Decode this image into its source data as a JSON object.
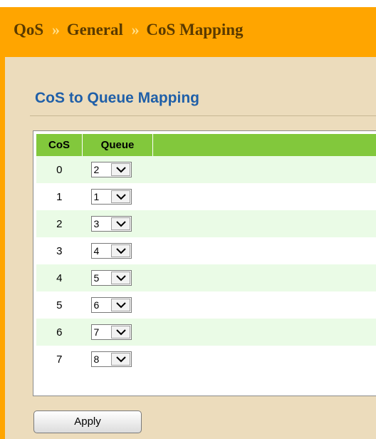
{
  "breadcrumb": {
    "items": [
      "QoS",
      "General",
      "CoS Mapping"
    ],
    "separator": "»"
  },
  "section": {
    "title": "CoS to Queue Mapping"
  },
  "table": {
    "headers": {
      "cos": "CoS",
      "queue": "Queue"
    },
    "rows": [
      {
        "cos": "0",
        "queue": "2"
      },
      {
        "cos": "1",
        "queue": "1"
      },
      {
        "cos": "2",
        "queue": "3"
      },
      {
        "cos": "3",
        "queue": "4"
      },
      {
        "cos": "4",
        "queue": "5"
      },
      {
        "cos": "5",
        "queue": "6"
      },
      {
        "cos": "6",
        "queue": "7"
      },
      {
        "cos": "7",
        "queue": "8"
      }
    ]
  },
  "actions": {
    "apply_label": "Apply"
  },
  "colors": {
    "header_bg": "#ffa500",
    "content_bg": "#ecdcbc",
    "title_color": "#1f5fa8",
    "table_header_bg": "#82c83c",
    "row_alt_bg": "#eafbe6"
  }
}
